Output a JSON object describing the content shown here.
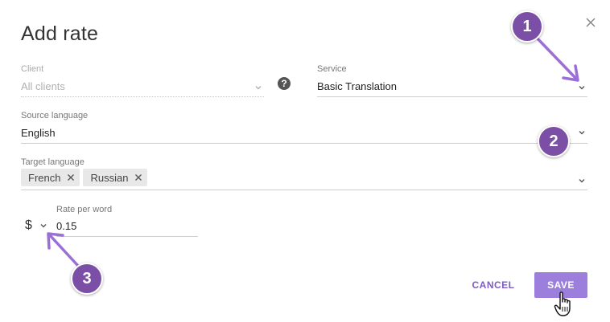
{
  "dialog": {
    "title": "Add rate"
  },
  "client": {
    "label": "Client",
    "value": "All clients"
  },
  "help": {
    "glyph": "?"
  },
  "service": {
    "label": "Service",
    "value": "Basic Translation"
  },
  "source_language": {
    "label": "Source language",
    "value": "English"
  },
  "target_language": {
    "label": "Target language",
    "chips": [
      {
        "label": "French"
      },
      {
        "label": "Russian"
      }
    ]
  },
  "rate": {
    "currency": "$",
    "label": "Rate per word",
    "value": "0.15"
  },
  "actions": {
    "cancel_label": "CANCEL",
    "save_label": "SAVE"
  },
  "annotations": [
    {
      "number": "1"
    },
    {
      "number": "2"
    },
    {
      "number": "3"
    }
  ],
  "colors": {
    "accent": "#7d5bc4",
    "save_bg": "#9c7fdc",
    "badge": "#7b4fa6",
    "arrow": "#9b6fd6"
  },
  "icons": {
    "close": "close-icon",
    "chevron": "chevron-down-icon",
    "chip_remove": "close-icon",
    "help": "help-icon",
    "cursor": "hand-cursor-icon"
  }
}
